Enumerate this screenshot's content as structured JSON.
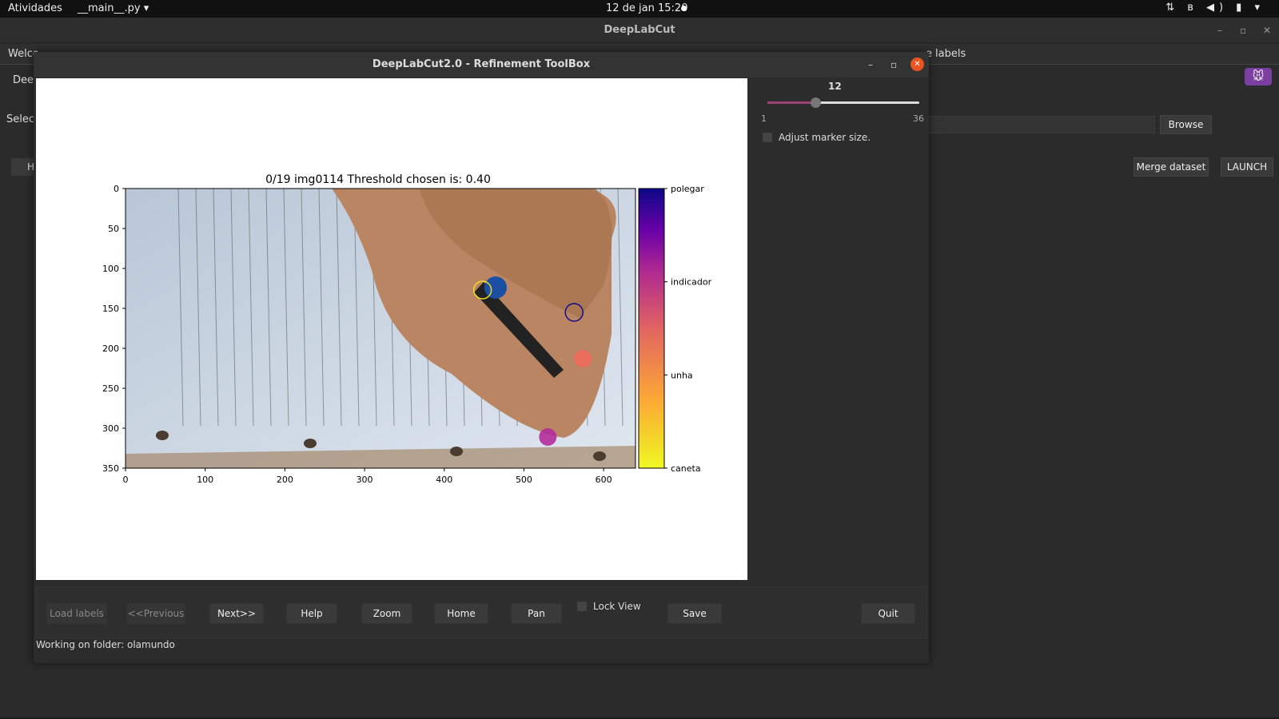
{
  "topbar": {
    "activities": "Atividades",
    "app_menu": "__main__.py ▾",
    "clock": "12 de jan  15:20",
    "tray_icons": [
      "network-icon",
      "bluetooth-icon",
      "volume-icon",
      "battery-icon",
      "power-menu-icon"
    ],
    "tray_glyphs": "⇅ ʙ ◀) ▮ ▾"
  },
  "main_window": {
    "title": "DeepLabCut",
    "controls": [
      "–",
      "▫",
      "✕"
    ],
    "tab_left": "Welco",
    "tab_right": "labels",
    "tab_right_prefix": "e",
    "left_label_1": "Deep",
    "left_label_2": "Select",
    "left_button": "H",
    "browse": "Browse",
    "merge": "Merge dataset",
    "launch": "LAUNCH"
  },
  "toolbox": {
    "title": "DeepLabCut2.0 - Refinement ToolBox",
    "minimize": "–",
    "maximize": "▫",
    "close": "✕",
    "slider": {
      "value": "12",
      "min": "1",
      "max": "36",
      "numeric_value": 12,
      "numeric_min": 1,
      "numeric_max": 36
    },
    "adjust_marker": "Adjust marker size.",
    "buttons": {
      "load_labels": "Load labels",
      "previous": "<<Previous",
      "next": "Next>>",
      "help": "Help",
      "zoom": "Zoom",
      "home": "Home",
      "pan": "Pan",
      "lock_view": "Lock View",
      "save": "Save",
      "quit": "Quit"
    },
    "status": "Working on folder: olamundo"
  },
  "plot": {
    "title": "0/19 img0114  Threshold chosen is: 0.40",
    "x_ticks": [
      "0",
      "100",
      "200",
      "300",
      "400",
      "500",
      "600"
    ],
    "y_ticks": [
      "0",
      "50",
      "100",
      "150",
      "200",
      "250",
      "300",
      "350"
    ],
    "colorbar_labels": [
      "polegar",
      "indicador",
      "unha",
      "caneta"
    ],
    "colors": {
      "polegar": "#1a0a8c",
      "indicador": "#b42b9a",
      "unha": "#f06a5a",
      "caneta": "#f0e020"
    }
  },
  "chart_data": {
    "type": "scatter",
    "title": "0/19 img0114  Threshold chosen is: 0.40",
    "xlim": [
      0,
      640
    ],
    "ylim": [
      350,
      0
    ],
    "points": [
      {
        "label": "caneta",
        "x": 448,
        "y": 127,
        "style": "ring"
      },
      {
        "label": "polegar",
        "x": 563,
        "y": 155,
        "style": "ring"
      },
      {
        "label": "unha",
        "x": 574,
        "y": 213,
        "style": "filled"
      },
      {
        "label": "indicador",
        "x": 530,
        "y": 311,
        "style": "filled"
      }
    ]
  }
}
